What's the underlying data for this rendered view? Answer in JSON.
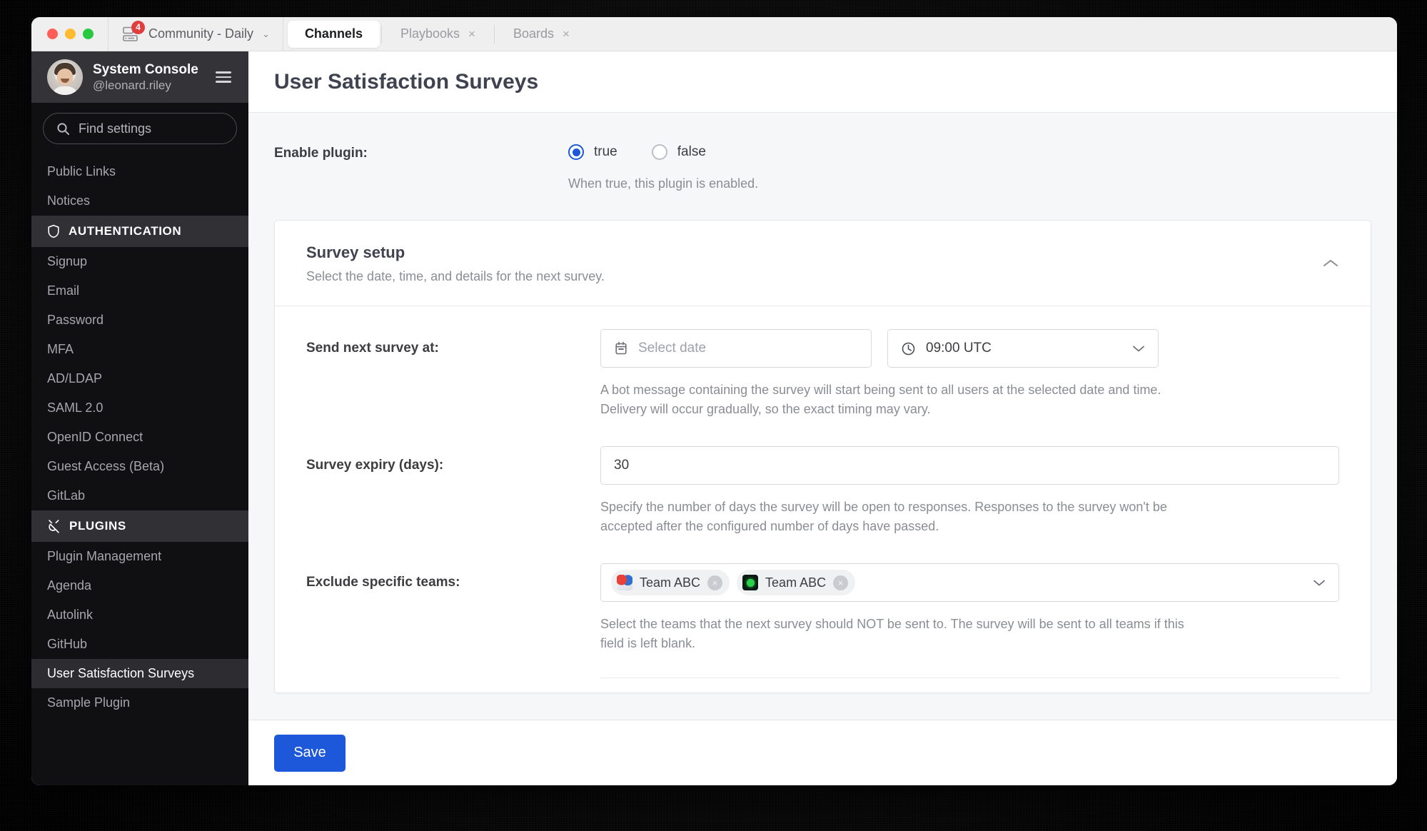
{
  "window": {
    "traffic_lights": [
      "close",
      "minimize",
      "zoom"
    ],
    "server": {
      "name": "Community - Daily",
      "unread_badge": "4",
      "icon": "server-icon",
      "caret": "⌄"
    },
    "tabs": [
      {
        "label": "Channels",
        "active": true,
        "closable": false
      },
      {
        "label": "Playbooks",
        "active": false,
        "closable": true
      },
      {
        "label": "Boards",
        "active": false,
        "closable": true
      }
    ],
    "tab_close_glyph": "×"
  },
  "sidebar": {
    "user": {
      "name": "System Console",
      "handle": "@leonard.riley",
      "avatar": "user-avatar",
      "menu_icon": "hamburger-icon"
    },
    "search": {
      "placeholder": "Find settings",
      "icon": "search-icon"
    },
    "items": [
      {
        "label": "Public Links",
        "type": "item",
        "selected": false
      },
      {
        "label": "Notices",
        "type": "item",
        "selected": false
      },
      {
        "label": "AUTHENTICATION",
        "type": "section",
        "icon": "shield-icon"
      },
      {
        "label": "Signup",
        "type": "item",
        "selected": false
      },
      {
        "label": "Email",
        "type": "item",
        "selected": false
      },
      {
        "label": "Password",
        "type": "item",
        "selected": false
      },
      {
        "label": "MFA",
        "type": "item",
        "selected": false
      },
      {
        "label": "AD/LDAP",
        "type": "item",
        "selected": false
      },
      {
        "label": "SAML 2.0",
        "type": "item",
        "selected": false
      },
      {
        "label": "OpenID Connect",
        "type": "item",
        "selected": false
      },
      {
        "label": "Guest Access (Beta)",
        "type": "item",
        "selected": false
      },
      {
        "label": "GitLab",
        "type": "item",
        "selected": false
      },
      {
        "label": "PLUGINS",
        "type": "section",
        "icon": "plug-icon"
      },
      {
        "label": "Plugin Management",
        "type": "item",
        "selected": false
      },
      {
        "label": "Agenda",
        "type": "item",
        "selected": false
      },
      {
        "label": "Autolink",
        "type": "item",
        "selected": false
      },
      {
        "label": "GitHub",
        "type": "item",
        "selected": false
      },
      {
        "label": "User Satisfaction Surveys",
        "type": "item",
        "selected": true
      },
      {
        "label": "Sample Plugin",
        "type": "item",
        "selected": false
      }
    ]
  },
  "main": {
    "page_title": "User Satisfaction Surveys",
    "enable_plugin": {
      "label": "Enable plugin:",
      "options": [
        {
          "label": "true",
          "selected": true
        },
        {
          "label": "false",
          "selected": false
        }
      ],
      "help": "When true, this plugin is enabled."
    },
    "card": {
      "title": "Survey setup",
      "subtitle": "Select the date, time, and details for the next survey.",
      "collapse_icon": "chevron-up-icon",
      "fields": {
        "send_next_survey": {
          "label": "Send next survey at:",
          "date_placeholder": "Select date",
          "date_value": "",
          "date_icon": "calendar-icon",
          "time_value": "09:00 UTC",
          "time_icon": "clock-icon",
          "time_caret": "⌄",
          "help": "A bot message containing the survey will start being sent to all users at the selected date and time. Delivery will occur gradually, so the exact timing may vary."
        },
        "survey_expiry": {
          "label": "Survey expiry (days):",
          "value": "30",
          "help": "Specify the number of days the survey will be open to responses. Responses to the survey won't be accepted after the configured number of days have passed."
        },
        "exclude_teams": {
          "label": "Exclude specific teams:",
          "chips": [
            {
              "label": "Team ABC",
              "icon": "team-icon-multicolor",
              "remove_glyph": "×"
            },
            {
              "label": "Team ABC",
              "icon": "team-icon-green",
              "remove_glyph": "×"
            }
          ],
          "caret": "⌄",
          "help": "Select the teams that the next survey should NOT be sent to. The survey will be sent to all teams if this field is left blank."
        }
      }
    },
    "save_button": "Save"
  },
  "colors": {
    "accent": "#1c58d9",
    "sidebar_bg": "#101012",
    "sidebar_section_bg": "#303035",
    "selected_item_bg": "#2c2c31",
    "badge_red": "#e03e3e",
    "page_bg": "#f6f7f8",
    "text_primary": "#3f4350",
    "text_muted": "#8a8d93"
  }
}
